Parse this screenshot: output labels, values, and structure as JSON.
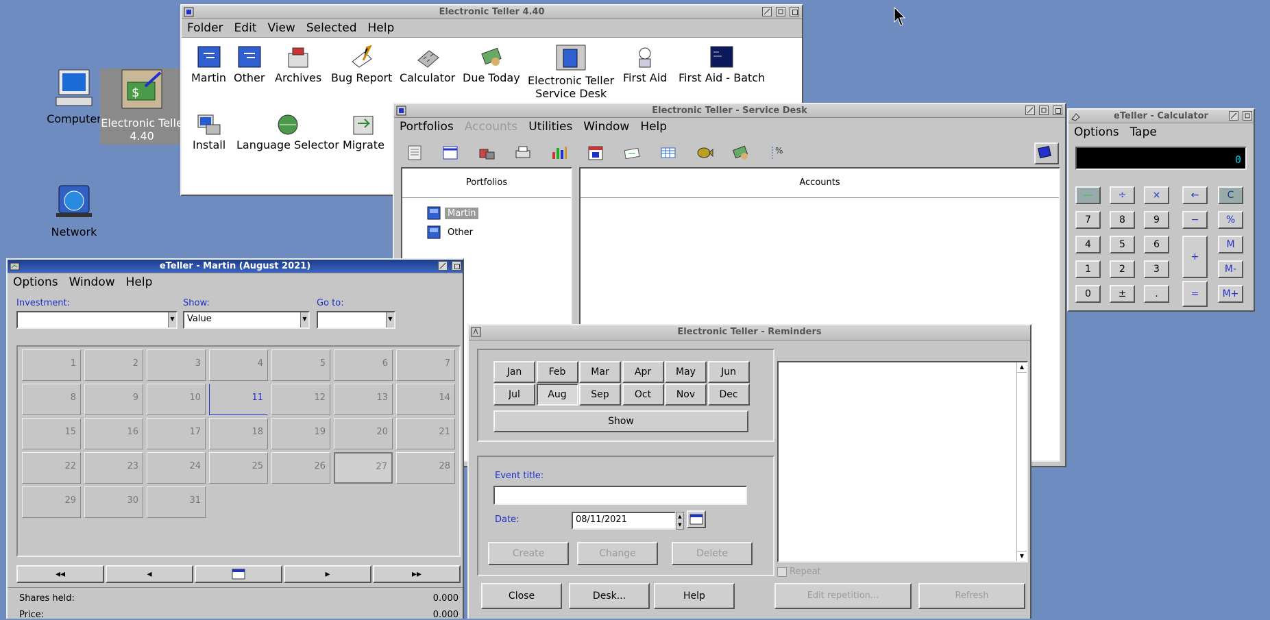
{
  "colors": {
    "desktop": "#6f8cc0",
    "window_face": "#c6c6c6",
    "active_title": "#1b3c8a",
    "calc_display": "#000000",
    "calc_display_text": "#00d0e0",
    "today_outline": "#2030c8"
  },
  "desktop": {
    "icons": [
      {
        "label": "Computer",
        "icon": "computer-icon"
      },
      {
        "label": "Electronic Teller 4.40",
        "label_line1": "Electronic Telle",
        "label_line2": "4.40",
        "icon": "electronic-teller-icon"
      },
      {
        "label": "Network",
        "icon": "network-icon"
      }
    ]
  },
  "folder_window": {
    "title": "Electronic Teller 4.40",
    "menu": [
      "Folder",
      "Edit",
      "View",
      "Selected",
      "Help"
    ],
    "icons": [
      {
        "label": "Martin",
        "icon": "portfolio-icon"
      },
      {
        "label": "Other",
        "icon": "portfolio-icon"
      },
      {
        "label": "Archives",
        "icon": "archives-icon"
      },
      {
        "label": "Bug Report",
        "icon": "bug-report-icon"
      },
      {
        "label": "Calculator",
        "icon": "calculator-icon"
      },
      {
        "label": "Due Today",
        "icon": "due-today-icon"
      },
      {
        "label": "Electronic Teller",
        "label2": "Service Desk",
        "icon": "service-desk-icon"
      },
      {
        "label": "First Aid",
        "icon": "first-aid-icon"
      },
      {
        "label": "First Aid - Batch",
        "icon": "first-aid-batch-icon"
      },
      {
        "label": "Install",
        "icon": "install-icon"
      },
      {
        "label": "Language Selector",
        "icon": "language-selector-icon"
      },
      {
        "label": "Migrate",
        "icon": "migrate-icon"
      }
    ]
  },
  "service_desk": {
    "title": "Electronic Teller - Service Desk",
    "menu": [
      "Portfolios",
      "Accounts",
      "Utilities",
      "Window",
      "Help"
    ],
    "portfolios_header": "Portfolios",
    "accounts_header": "Accounts",
    "portfolios": [
      "Martin",
      "Other"
    ],
    "selected_portfolio": "Martin"
  },
  "calculator": {
    "title": "eTeller - Calculator",
    "menu": [
      "Options",
      "Tape"
    ],
    "display": "0",
    "keys": {
      "row1": [
        "—",
        "÷",
        "×",
        "←",
        "C"
      ],
      "row2": [
        "7",
        "8",
        "9",
        "−",
        "%"
      ],
      "row3": [
        "4",
        "5",
        "6",
        "+",
        "M"
      ],
      "row4": [
        "1",
        "2",
        "3",
        "M-"
      ],
      "row5": [
        "0",
        "±",
        ".",
        "=",
        "M+"
      ]
    }
  },
  "calendar_window": {
    "title": "eTeller - Martin (August 2021)",
    "menu": [
      "Options",
      "Window",
      "Help"
    ],
    "investment_label": "Investment:",
    "investment_value": "",
    "show_label": "Show:",
    "show_value": "Value",
    "goto_label": "Go to:",
    "goto_value": "",
    "days": [
      "1",
      "2",
      "3",
      "4",
      "5",
      "6",
      "7",
      "8",
      "9",
      "10",
      "11",
      "12",
      "13",
      "14",
      "15",
      "16",
      "17",
      "18",
      "19",
      "20",
      "21",
      "22",
      "23",
      "24",
      "25",
      "26",
      "27",
      "28",
      "29",
      "30",
      "31"
    ],
    "today": "11",
    "selected_day": "27",
    "nav": [
      "◂◂",
      "◂",
      "▸",
      "▸▸"
    ],
    "shares_label": "Shares held:",
    "shares_value": "0.000",
    "price_label": "Price:",
    "price_value": "0.000"
  },
  "reminders": {
    "title": "Electronic Teller - Reminders",
    "months": [
      "Jan",
      "Feb",
      "Mar",
      "Apr",
      "May",
      "Jun",
      "Jul",
      "Aug",
      "Sep",
      "Oct",
      "Nov",
      "Dec"
    ],
    "selected_month": "Aug",
    "show_button": "Show",
    "event_title_label": "Event title:",
    "event_title_value": "",
    "date_label": "Date:",
    "date_value": "08/11/2021",
    "create": "Create",
    "change": "Change",
    "delete": "Delete",
    "close": "Close",
    "desk": "Desk...",
    "help": "Help",
    "repeat": "Repeat",
    "edit_repetition": "Edit repetition...",
    "refresh": "Refresh"
  }
}
